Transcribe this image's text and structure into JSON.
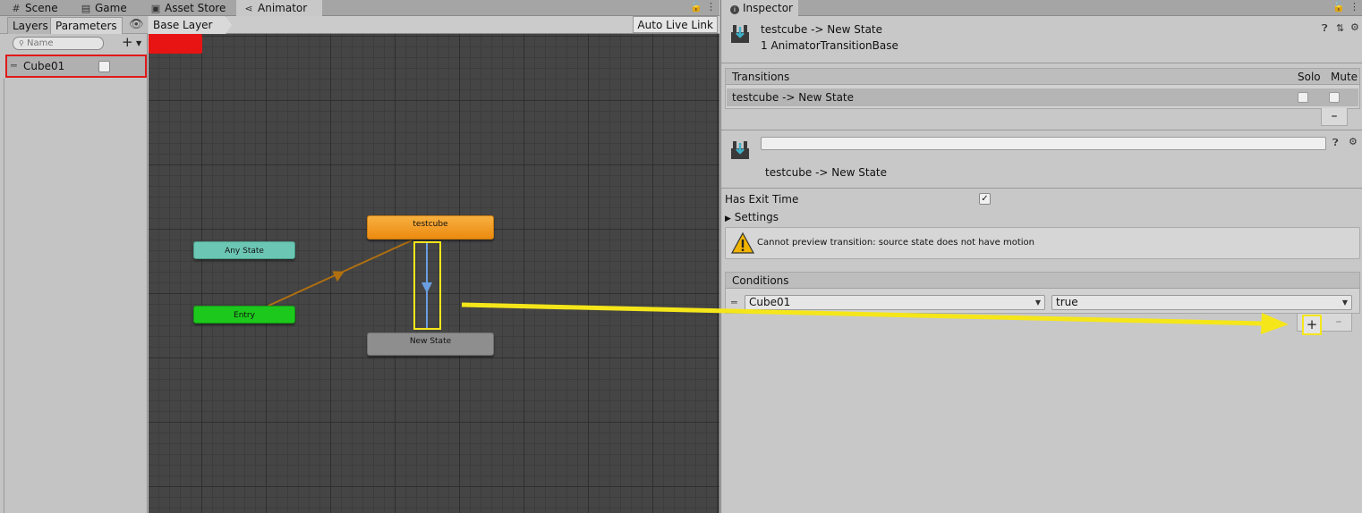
{
  "tabs": [
    {
      "label": "Scene",
      "icon": "grid-icon"
    },
    {
      "label": "Game",
      "icon": "gamepad-icon"
    },
    {
      "label": "Asset Store",
      "icon": "bag-icon"
    },
    {
      "label": "Animator",
      "icon": "animator-icon"
    }
  ],
  "left_panel": {
    "tab_layers": "Layers",
    "tab_parameters": "Parameters",
    "search_placeholder": "Name",
    "parameter": {
      "name": "Cube01",
      "value": false
    }
  },
  "graph": {
    "breadcrumb": "Base Layer",
    "auto_live_link": "Auto Live Link",
    "nodes": {
      "any_state": "Any State",
      "entry": "Entry",
      "testcube": "testcube",
      "new_state": "New State"
    }
  },
  "inspector": {
    "tab": "Inspector",
    "title": "testcube -> New State",
    "subtitle": "1 AnimatorTransitionBase",
    "transitions": {
      "header": "Transitions",
      "solo": "Solo",
      "mute": "Mute",
      "row": "testcube -> New State"
    },
    "transition_name_value": "",
    "state_label": "testcube -> New State",
    "has_exit_time_label": "Has Exit Time",
    "has_exit_time": true,
    "settings_label": "Settings",
    "warning": "Cannot preview transition: source state does not have motion",
    "conditions": {
      "header": "Conditions",
      "parameter": "Cube01",
      "value": "true"
    }
  },
  "colors": {
    "highlight_red": "#e01a1a",
    "highlight_yellow": "#f5e61a",
    "node_orange": "#f29a20",
    "node_green": "#1cc81c",
    "node_teal": "#6cc6b4",
    "node_gray": "#8e8e8e",
    "graph_bg": "#454545"
  }
}
